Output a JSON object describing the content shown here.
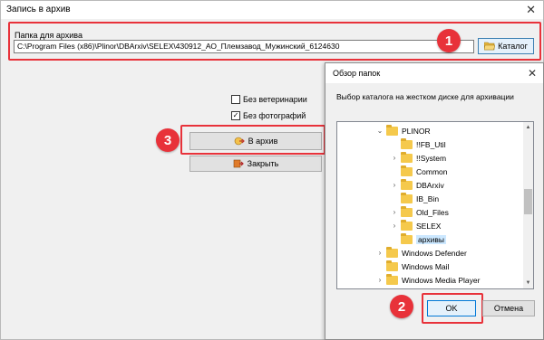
{
  "main_window": {
    "title": "Запись в архив",
    "close_glyph": "✕"
  },
  "folder_group": {
    "label": "Папка для архива",
    "path": "C:\\Program Files (x86)\\Plinor\\DBArxiv\\SELEX\\430912_АО_Племзавод_Мужинский_6124630",
    "catalog_button": "Каталог",
    "catalog_icon": "open-folder-icon"
  },
  "options": {
    "no_vet_label": "Без ветеринарии",
    "no_vet_checked": false,
    "no_photo_label": "Без фотографий",
    "no_photo_checked": true
  },
  "actions": {
    "archive_label": "В архив",
    "archive_icon": "archive-icon",
    "close_label": "Закрыть",
    "close_icon": "close-icon"
  },
  "badges": {
    "one": "1",
    "two": "2",
    "three": "3"
  },
  "badge_color": "#e8323a",
  "browse_dialog": {
    "title": "Обзор папок",
    "close_glyph": "✕",
    "description": "Выбор каталога на жестком диске для архивации",
    "tree": [
      {
        "label": "PLINOR",
        "chevron": "⌄",
        "level": 0
      },
      {
        "label": "!!FB_Util",
        "chevron": "",
        "level": 1
      },
      {
        "label": "!!System",
        "chevron": "›",
        "level": 1
      },
      {
        "label": "Common",
        "chevron": "",
        "level": 1
      },
      {
        "label": "DBArxiv",
        "chevron": "›",
        "level": 1
      },
      {
        "label": "IB_Bin",
        "chevron": "",
        "level": 1
      },
      {
        "label": "Old_Files",
        "chevron": "›",
        "level": 1
      },
      {
        "label": "SELEX",
        "chevron": "›",
        "level": 1
      },
      {
        "label": "архивы",
        "chevron": "",
        "level": 1,
        "selected": true
      },
      {
        "label": "Windows Defender",
        "chevron": "›",
        "level": 0
      },
      {
        "label": "Windows Mail",
        "chevron": "",
        "level": 0
      },
      {
        "label": "Windows Media Player",
        "chevron": "›",
        "level": 0
      }
    ],
    "ok_label": "OK",
    "cancel_label": "Отмена"
  }
}
